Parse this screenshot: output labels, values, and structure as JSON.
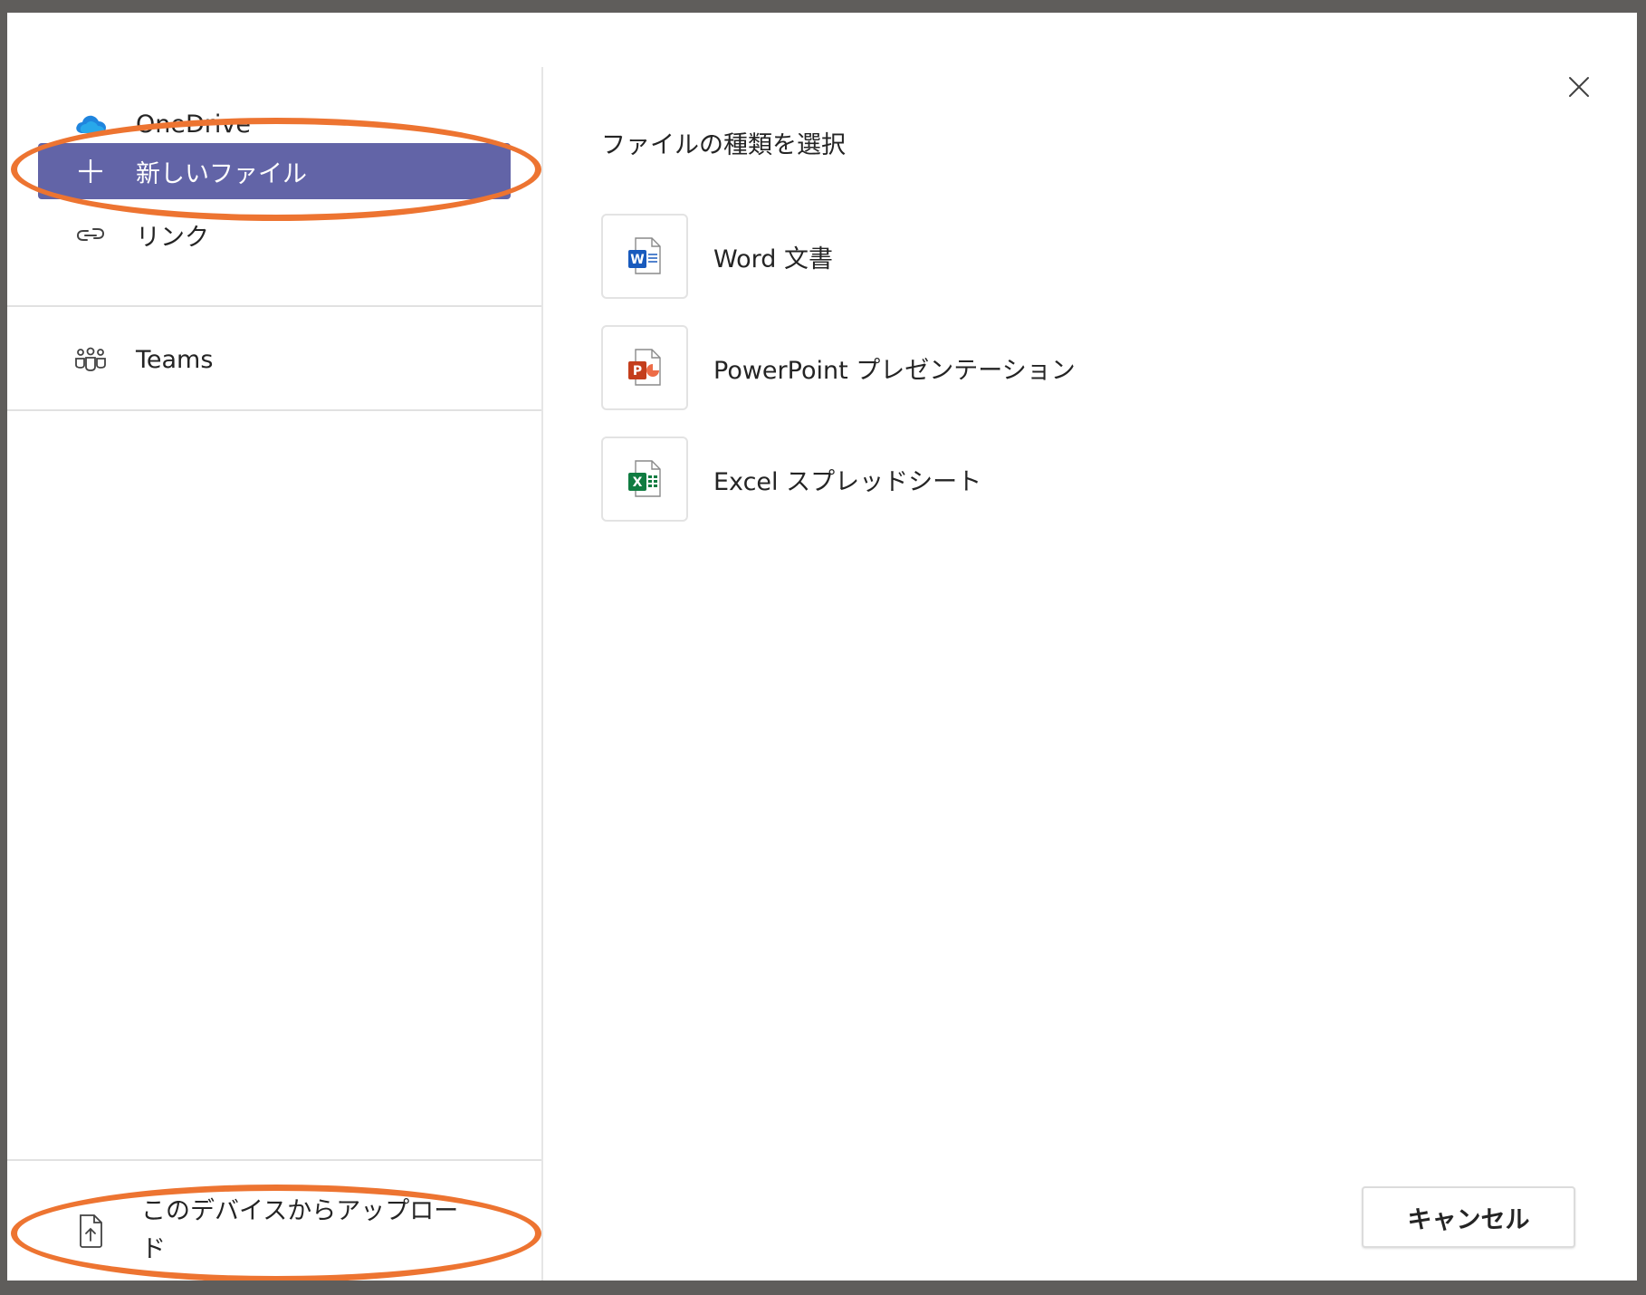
{
  "nav": {
    "onedrive_label": "OneDrive",
    "new_file_label": "新しいファイル",
    "link_label": "リンク",
    "teams_label": "Teams",
    "upload_label": "このデバイスからアップロード"
  },
  "main": {
    "title": "ファイルの種類を選択",
    "file_types": [
      {
        "label": "Word 文書",
        "icon": "word-icon"
      },
      {
        "label": "PowerPoint プレゼンテーション",
        "icon": "powerpoint-icon"
      },
      {
        "label": "Excel スプレッドシート",
        "icon": "excel-icon"
      }
    ]
  },
  "footer": {
    "cancel_label": "キャンセル"
  },
  "colors": {
    "active_nav": "#6264a7",
    "annotation": "#ed7431",
    "word": "#185abd",
    "powerpoint": "#c43e1c",
    "excel": "#107c41",
    "onedrive": "#0f6cbd"
  }
}
